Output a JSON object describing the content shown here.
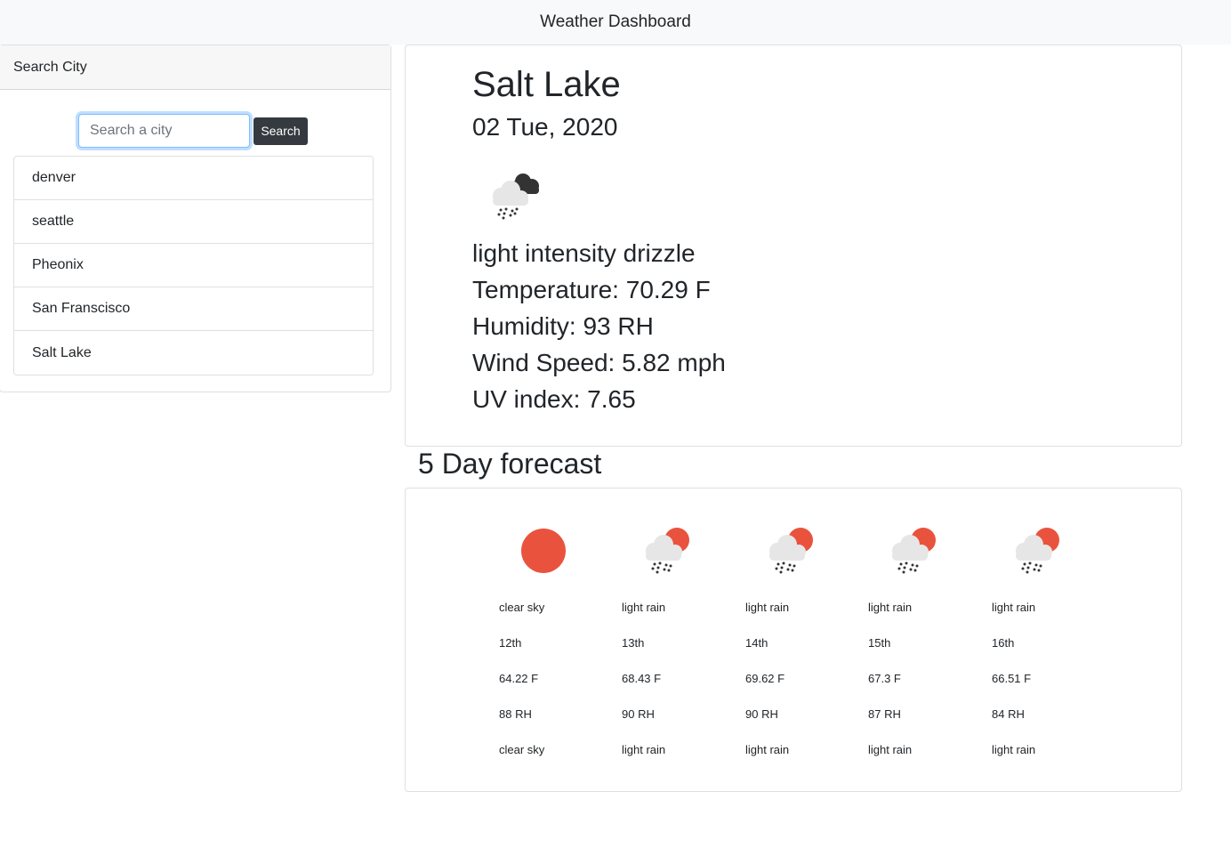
{
  "navbar": {
    "title": "Weather Dashboard"
  },
  "sidebar": {
    "header": "Search City",
    "search": {
      "placeholder": "Search a city",
      "value": "",
      "button_label": "Search"
    },
    "cities": [
      "denver",
      "seattle",
      "Pheonix",
      "San Franscisco",
      "Salt Lake"
    ]
  },
  "current": {
    "city": "Salt Lake",
    "date": "02 Tue, 2020",
    "icon": "rain-cloud-icon",
    "description": "light intensity drizzle",
    "temperature": "Temperature: 70.29 F",
    "humidity": "Humidity: 93 RH",
    "wind": "Wind Speed: 5.82 mph",
    "uv": "UV index: 7.65"
  },
  "forecast": {
    "title": "5 Day forecast",
    "days": [
      {
        "icon": "sun-icon",
        "desc": "clear sky",
        "date": "12th",
        "temp": "64.22 F",
        "humidity": "88 RH",
        "desc2": "clear sky"
      },
      {
        "icon": "sun-rain-icon",
        "desc": "light rain",
        "date": "13th",
        "temp": "68.43 F",
        "humidity": "90 RH",
        "desc2": "light rain"
      },
      {
        "icon": "sun-rain-icon",
        "desc": "light rain",
        "date": "14th",
        "temp": "69.62 F",
        "humidity": "90 RH",
        "desc2": "light rain"
      },
      {
        "icon": "sun-rain-icon",
        "desc": "light rain",
        "date": "15th",
        "temp": "67.3 F",
        "humidity": "87 RH",
        "desc2": "light rain"
      },
      {
        "icon": "sun-rain-icon",
        "desc": "light rain",
        "date": "16th",
        "temp": "66.51 F",
        "humidity": "84 RH",
        "desc2": "light rain"
      }
    ]
  },
  "colors": {
    "sun": "#e9533e",
    "cloud": "#e6e6e6",
    "dark_cloud": "#333333",
    "button": "#343a40",
    "navbar": "#f8f9fa"
  }
}
